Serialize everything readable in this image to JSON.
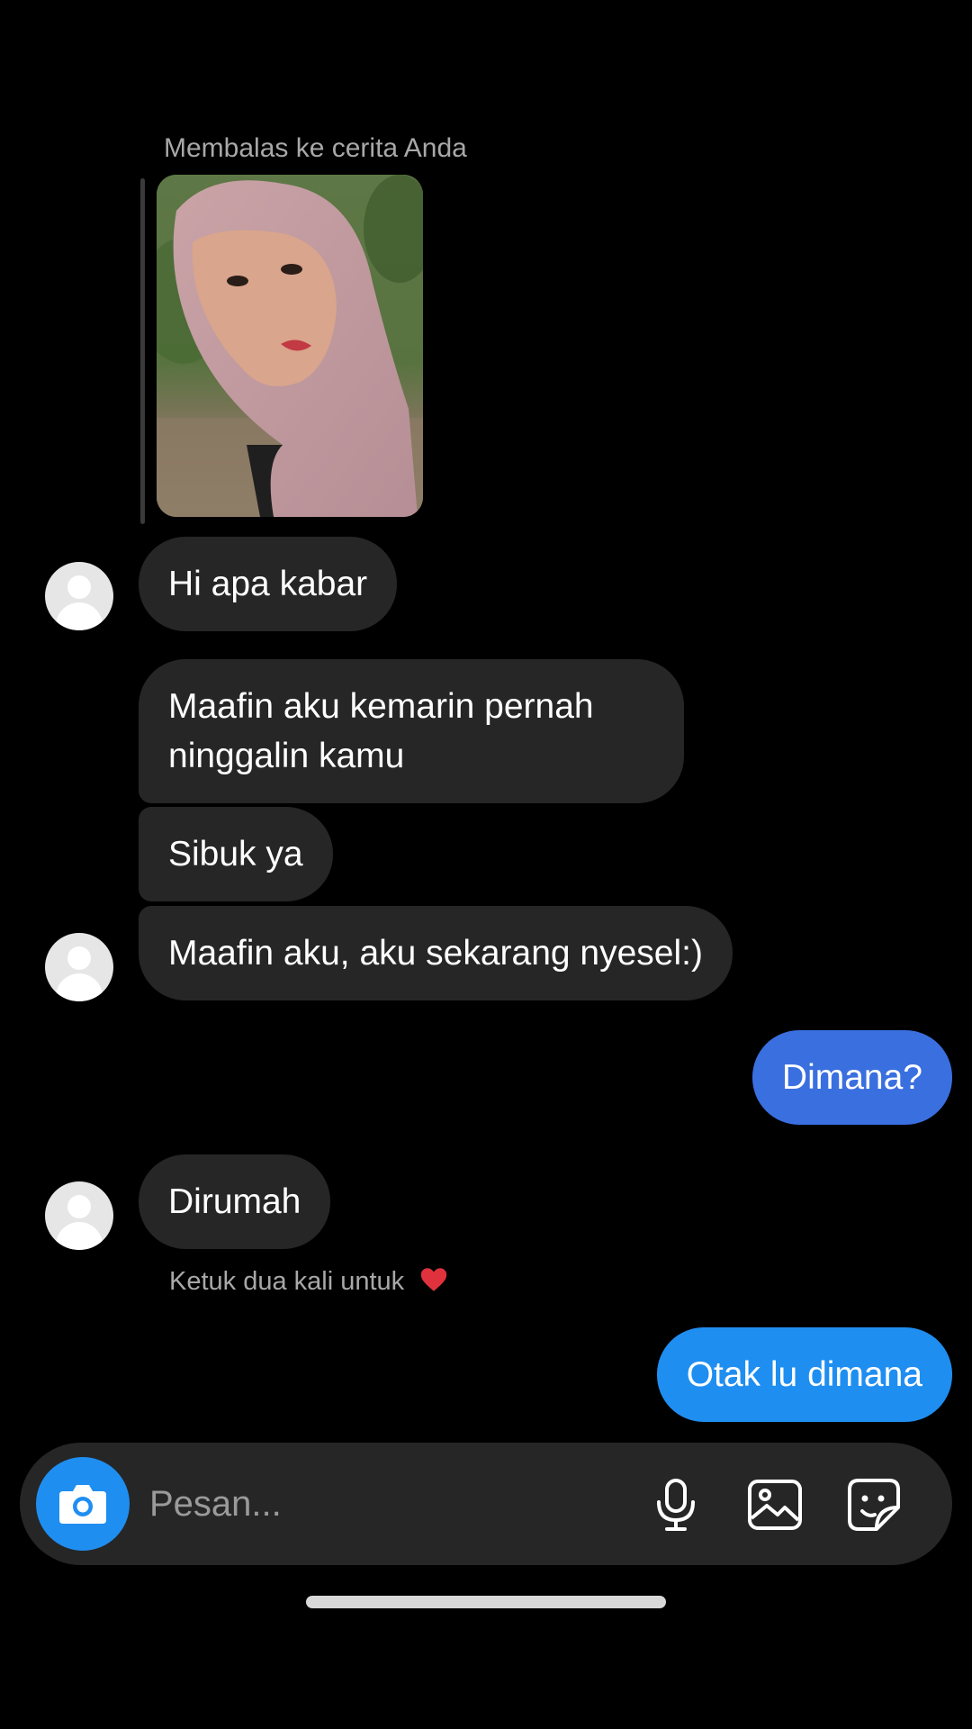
{
  "story_reply": {
    "label": "Membalas ke cerita Anda"
  },
  "messages": [
    {
      "from": "them",
      "text": "Hi apa kabar"
    },
    {
      "from": "them",
      "text": "Maafin aku kemarin pernah\nninggalin kamu"
    },
    {
      "from": "them",
      "text": "Sibuk ya"
    },
    {
      "from": "them",
      "text": "Maafin aku, aku sekarang nyesel:)"
    },
    {
      "from": "me",
      "text": "Dimana?"
    },
    {
      "from": "them",
      "text": "Dirumah"
    },
    {
      "from": "me",
      "text": "Otak lu dimana"
    }
  ],
  "hint": {
    "text": "Ketuk dua kali untuk",
    "icon": "heart-icon"
  },
  "composer": {
    "placeholder": "Pesan..."
  },
  "colors": {
    "background": "#000000",
    "incoming_bubble": "#262626",
    "outgoing_bubble_1": "#3a6fe0",
    "outgoing_bubble_2": "#1f8ef1",
    "camera_button": "#1f8ef1",
    "heart": "#e0323c"
  }
}
